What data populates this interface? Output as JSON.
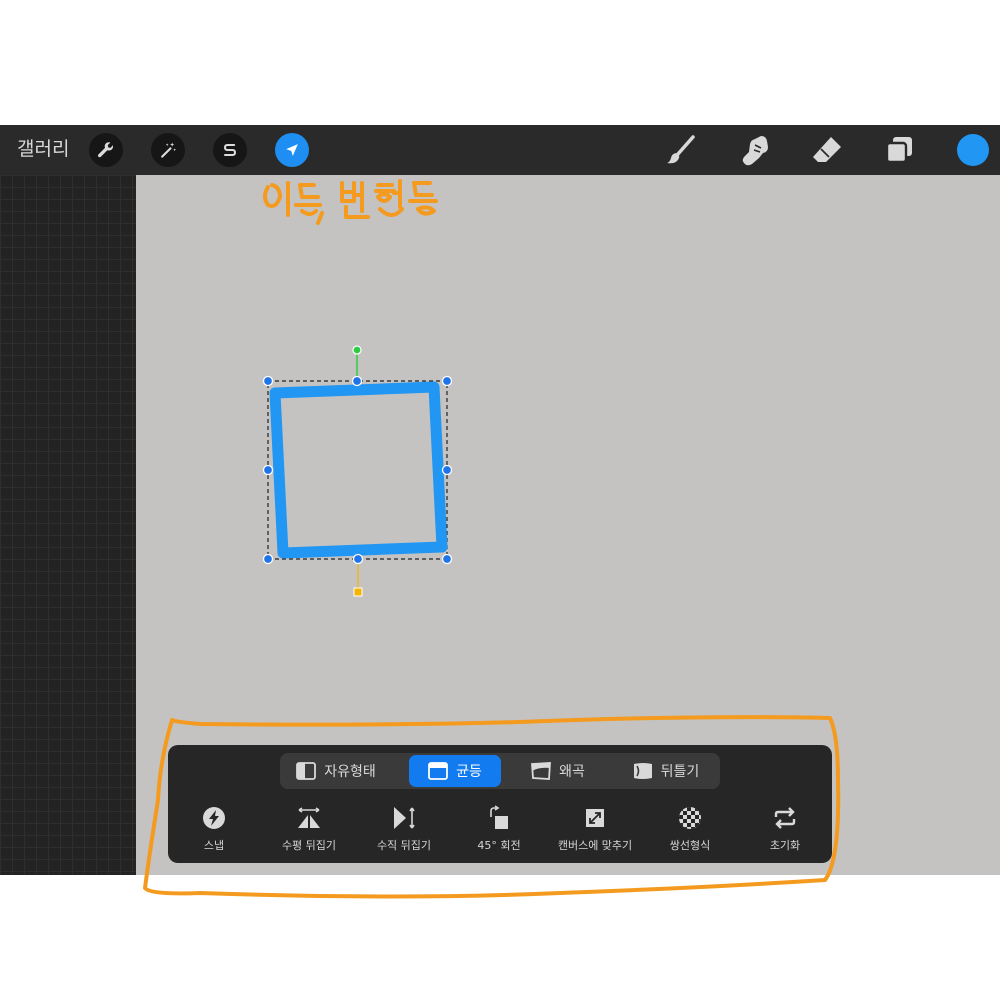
{
  "toolbar": {
    "gallery_label": "갤러리",
    "left_tools": [
      {
        "icon": "wrench-icon",
        "name": "actions-button"
      },
      {
        "icon": "magic-wand-icon",
        "name": "adjustments-button"
      },
      {
        "icon": "selection-s-icon",
        "name": "selection-button"
      },
      {
        "icon": "arrow-cursor-icon",
        "name": "transform-button",
        "active": true
      }
    ],
    "right_tools": [
      {
        "icon": "brush-icon",
        "name": "brush-button"
      },
      {
        "icon": "smudge-finger-icon",
        "name": "smudge-button"
      },
      {
        "icon": "eraser-icon",
        "name": "eraser-button"
      },
      {
        "icon": "layers-icon",
        "name": "layers-button"
      }
    ],
    "current_color": "#2196f3",
    "accent_color": "#1e8ef2"
  },
  "annotation": {
    "handwritten_note": "이동, 변형 등",
    "note_color": "#f39a1f"
  },
  "transform_panel": {
    "modes": [
      {
        "label": "자유형태",
        "icon": "freeform-icon",
        "active": false
      },
      {
        "label": "균등",
        "icon": "uniform-icon",
        "active": true
      },
      {
        "label": "왜곡",
        "icon": "distort-icon",
        "active": false
      },
      {
        "label": "뒤틀기",
        "icon": "warp-icon",
        "active": false
      }
    ],
    "actions": [
      {
        "label": "스냅",
        "icon": "snap-lightning-icon"
      },
      {
        "label": "수평 뒤집기",
        "icon": "flip-horizontal-icon"
      },
      {
        "label": "수직 뒤집기",
        "icon": "flip-vertical-icon"
      },
      {
        "label": "45° 회전",
        "icon": "rotate-45-icon"
      },
      {
        "label": "캔버스에 맞추기",
        "icon": "fit-to-canvas-icon"
      },
      {
        "label": "쌍선형식",
        "icon": "bilinear-checker-icon"
      },
      {
        "label": "초기화",
        "icon": "reset-arrows-icon"
      }
    ]
  }
}
